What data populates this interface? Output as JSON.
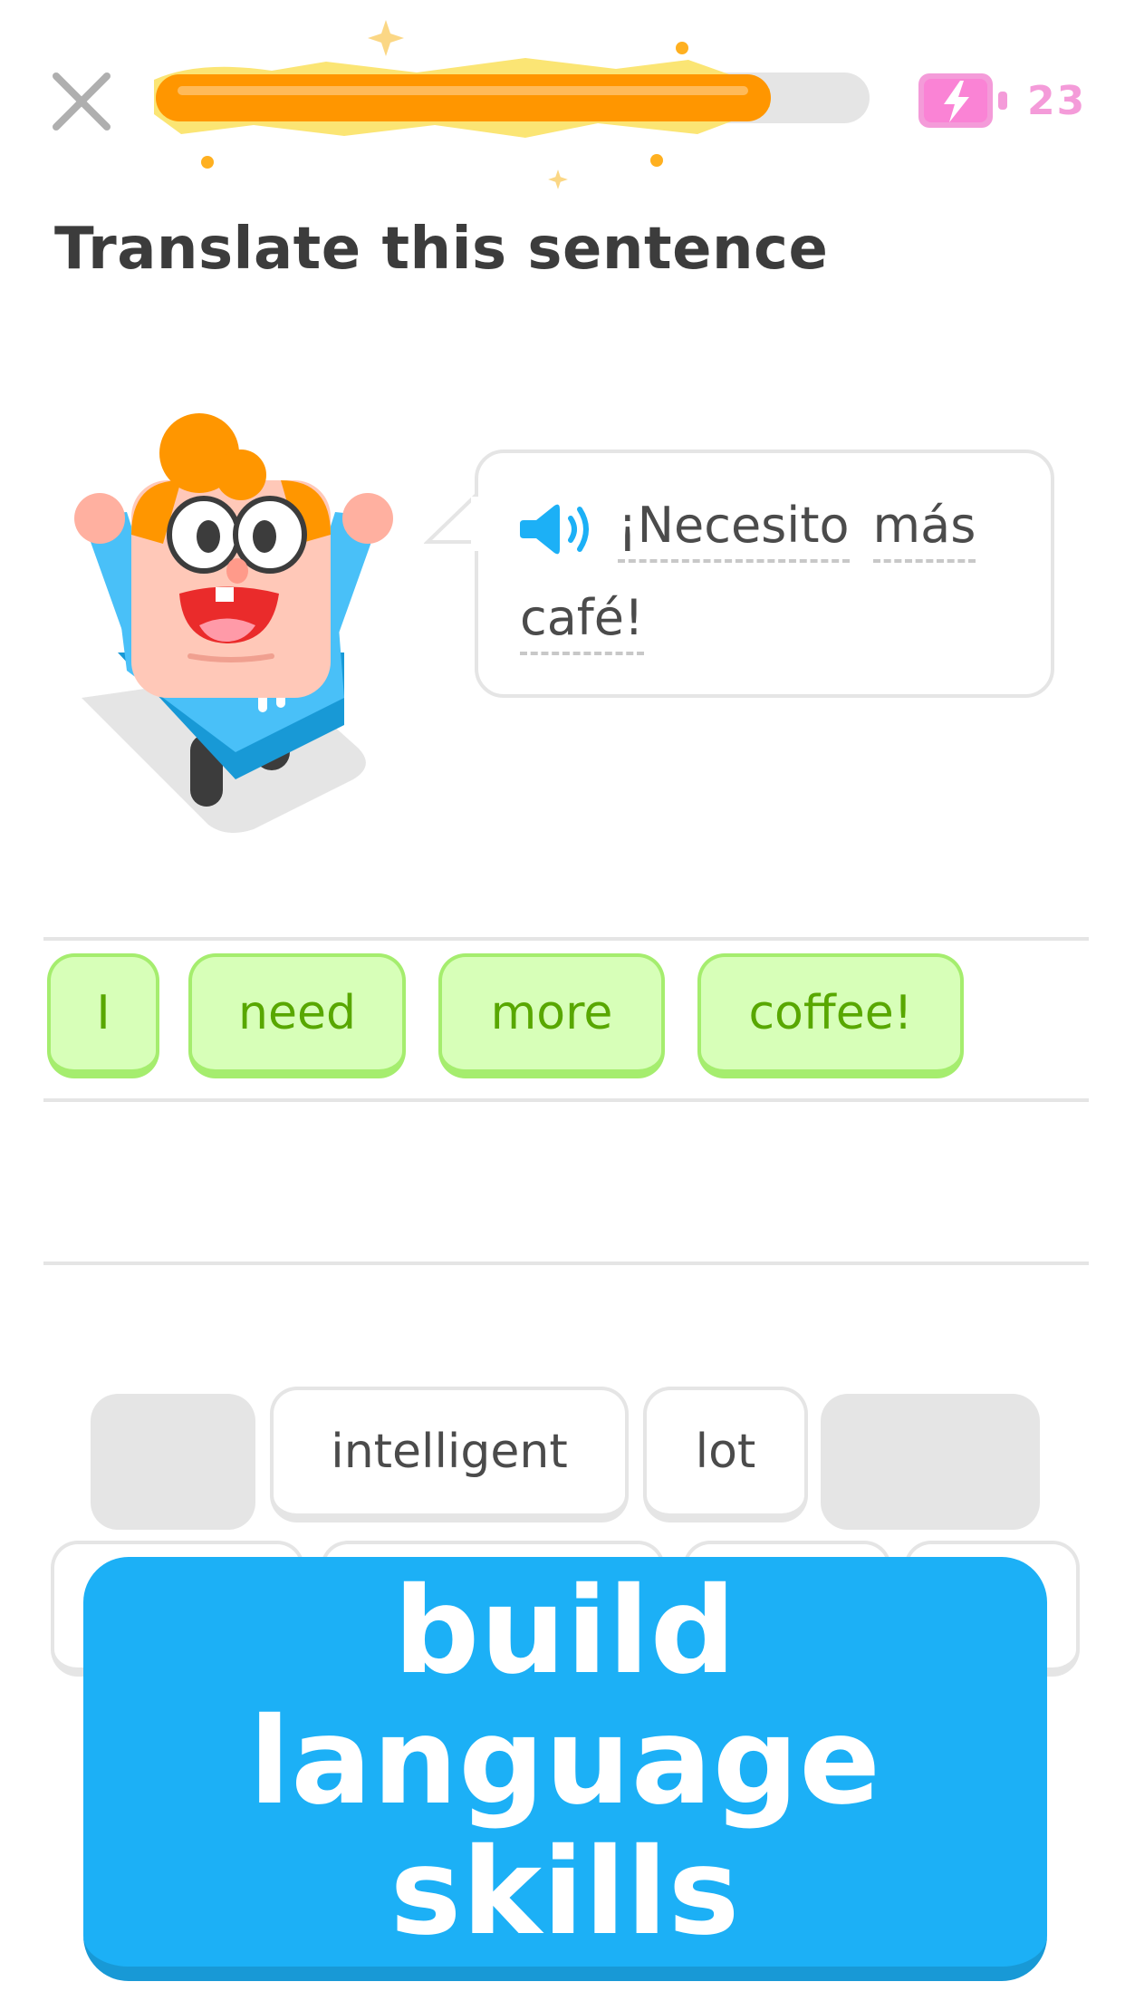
{
  "header": {
    "close_icon": "close-icon",
    "progress_percent": 86,
    "energy_icon": "battery-bolt-icon",
    "energy_count": "23"
  },
  "prompt": {
    "title": "Translate this sentence"
  },
  "sentence": {
    "speaker_icon": "speaker-icon",
    "words": [
      "¡Necesito",
      "más",
      "café!"
    ]
  },
  "answer": {
    "chips": [
      "I",
      "need",
      "more",
      "coffee!"
    ]
  },
  "word_bank": {
    "row1": [
      "intelligent",
      "lot"
    ]
  },
  "cta": {
    "line1": "build",
    "line2": "language skills"
  },
  "colors": {
    "accent_blue": "#1cb0f6",
    "progress_orange": "#ff9600",
    "correct_green": "#58a700",
    "energy_pink": "#f49bd9"
  }
}
